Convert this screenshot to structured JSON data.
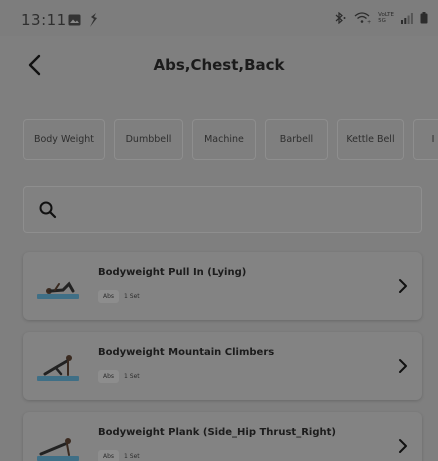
{
  "status_bar": {
    "time": "13:11",
    "left_icons": [
      "image-icon",
      "app-notification-icon"
    ],
    "right_icons": [
      "bluetooth-icon",
      "wifi-icon",
      "volte-5g-icon",
      "signal-icon",
      "battery-icon"
    ],
    "volte_label": "VoLTE",
    "network_label": "5G"
  },
  "header": {
    "title": "Abs,Chest,Back"
  },
  "filters": [
    {
      "label": "Body Weight"
    },
    {
      "label": "Dumbbell"
    },
    {
      "label": "Machine"
    },
    {
      "label": "Barbell"
    },
    {
      "label": "Kettle Bell"
    },
    {
      "label": "I"
    }
  ],
  "search": {
    "placeholder": "",
    "value": ""
  },
  "exercises": [
    {
      "name": "Bodyweight Pull In (Lying)",
      "tag": "Abs",
      "sets": "1 Set",
      "thumb_icon": "lying-pull-in-icon"
    },
    {
      "name": "Bodyweight Mountain Climbers",
      "tag": "Abs",
      "sets": "1 Set",
      "thumb_icon": "mountain-climber-icon"
    },
    {
      "name": "Bodyweight Plank (Side_Hip Thrust_Right)",
      "tag": "Abs",
      "sets": "1 Set",
      "thumb_icon": "side-plank-icon"
    }
  ],
  "colors": {
    "overlay": "#7f7f7f",
    "mat": "#3f6f86",
    "text": "#1c1c1c"
  }
}
